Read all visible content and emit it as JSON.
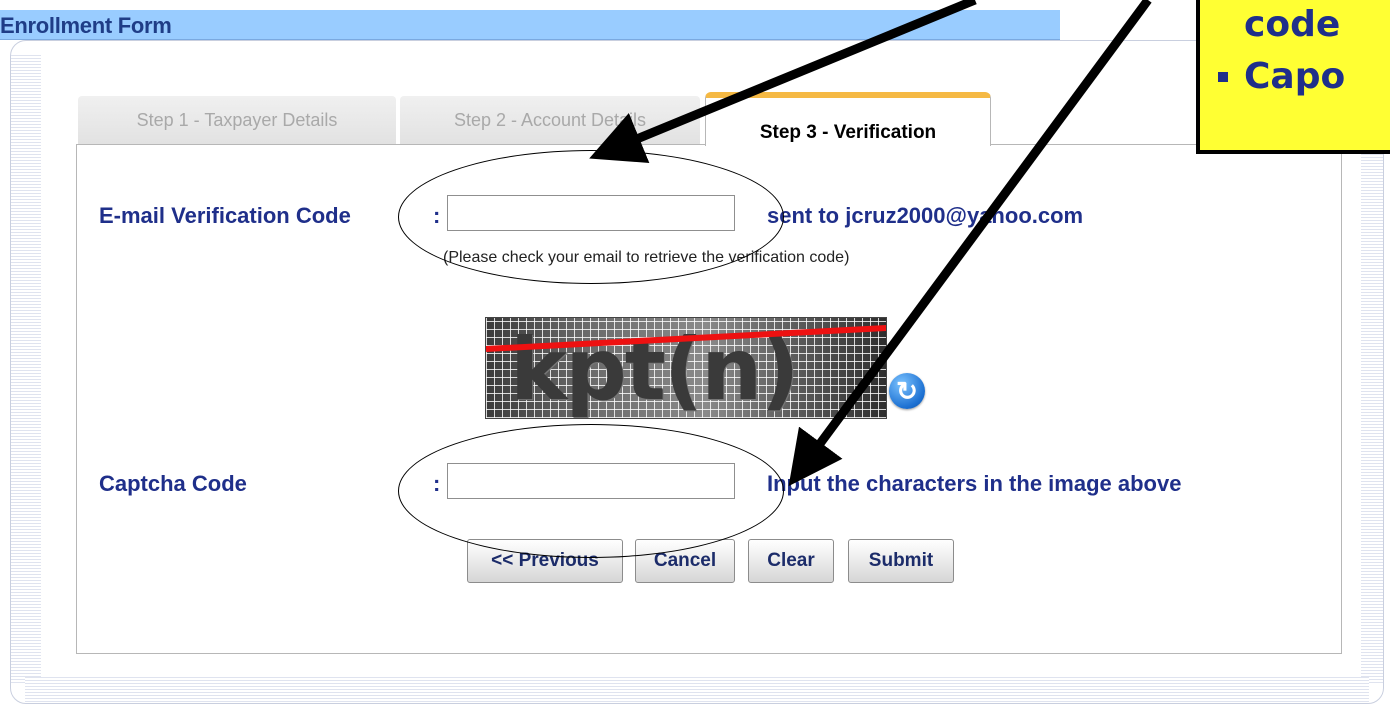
{
  "header": {
    "title": "Enrollment Form"
  },
  "tabs": [
    {
      "label": "Step 1 - Taxpayer Details",
      "state": "inactive"
    },
    {
      "label": "Step 2 - Account Details",
      "state": "inactive"
    },
    {
      "label": "Step 3 - Verification",
      "state": "active"
    }
  ],
  "email_verification": {
    "label": "E-mail Verification Code",
    "colon": ":",
    "value": "",
    "sent_to": "sent to jcruz2000@yahoo.com",
    "hint": "(Please check your email to retrieve the verification code)"
  },
  "captcha": {
    "image_text": "kpt(n)",
    "refresh_icon": "refresh-icon",
    "label": "Captcha Code",
    "colon": ":",
    "value": "",
    "instruction": "Input the characters in the image above"
  },
  "buttons": {
    "previous": "<< Previous",
    "cancel": "Cancel",
    "clear": "Clear",
    "submit": "Submit"
  },
  "callout": {
    "line1": "code",
    "line2": "Capo"
  },
  "colors": {
    "header_bg": "#99ccff",
    "label_text": "#1f2f8a",
    "active_tab_accent": "#f5b944",
    "callout_bg": "#ffff33",
    "captcha_line": "#ee1111"
  }
}
